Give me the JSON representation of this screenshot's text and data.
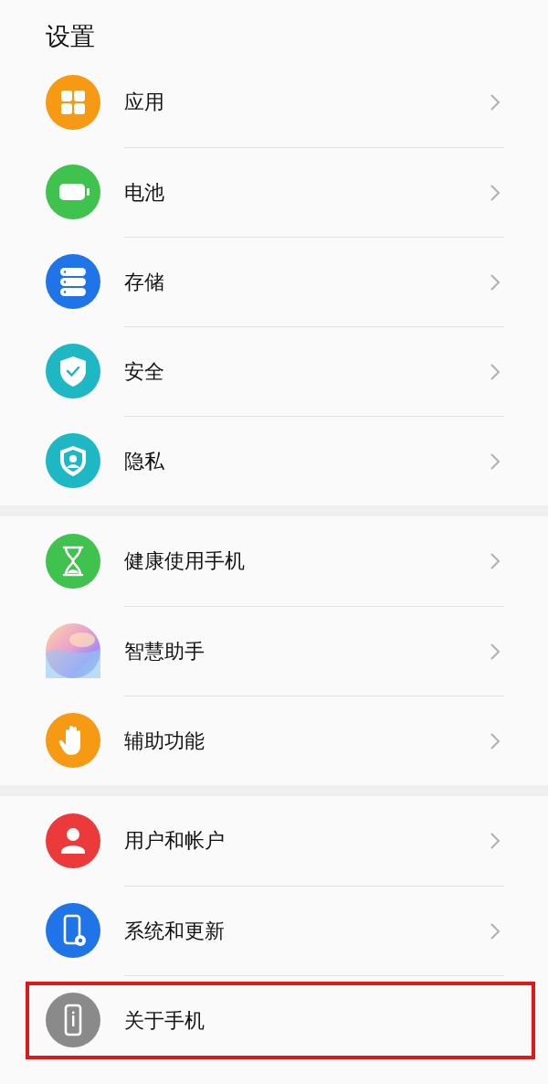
{
  "title": "设置",
  "groups": [
    {
      "items": [
        {
          "label": "应用",
          "kind": "grid",
          "color": "#f59a12",
          "chevron": true,
          "highlighted": false
        },
        {
          "label": "电池",
          "kind": "battery",
          "color": "#3fc24e",
          "chevron": true,
          "highlighted": false
        },
        {
          "label": "存储",
          "kind": "storage",
          "color": "#1f74e8",
          "chevron": true,
          "highlighted": false
        },
        {
          "label": "安全",
          "kind": "shield-check",
          "color": "#1db8c4",
          "chevron": true,
          "highlighted": false
        },
        {
          "label": "隐私",
          "kind": "shield-person",
          "color": "#1db8c4",
          "chevron": true,
          "highlighted": false
        }
      ]
    },
    {
      "items": [
        {
          "label": "健康使用手机",
          "kind": "hourglass",
          "color": "#3fc24e",
          "chevron": true,
          "highlighted": false
        },
        {
          "label": "智慧助手",
          "kind": "orb",
          "chevron": true,
          "highlighted": false
        },
        {
          "label": "辅助功能",
          "kind": "hand",
          "color": "#f59a12",
          "chevron": true,
          "highlighted": false
        }
      ]
    },
    {
      "items": [
        {
          "label": "用户和帐户",
          "kind": "person",
          "color": "#ec3a3a",
          "chevron": true,
          "highlighted": false
        },
        {
          "label": "系统和更新",
          "kind": "phone-gear",
          "color": "#1f74e8",
          "chevron": true,
          "highlighted": false
        },
        {
          "label": "关于手机",
          "kind": "phone-info",
          "color": "#8a8a8a",
          "chevron": false,
          "highlighted": true
        }
      ]
    }
  ]
}
